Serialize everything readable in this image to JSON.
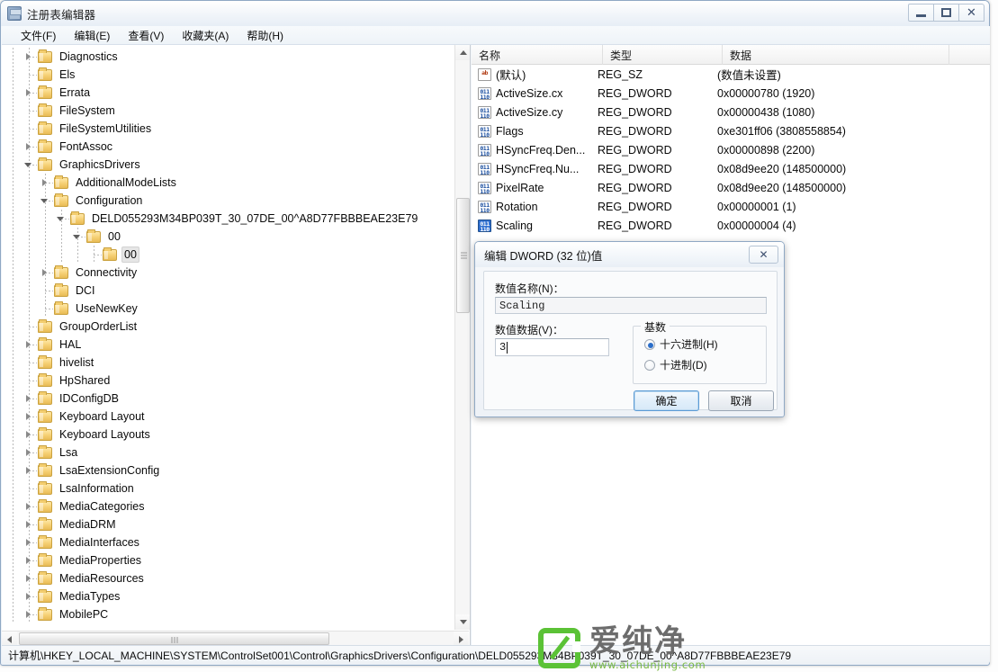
{
  "window": {
    "title": "注册表编辑器",
    "controls": {
      "minimize": "—",
      "maximize": "□",
      "close": "✕"
    }
  },
  "menu": {
    "items": [
      {
        "label": "文件(F)"
      },
      {
        "label": "编辑(E)"
      },
      {
        "label": "查看(V)"
      },
      {
        "label": "收藏夹(A)"
      },
      {
        "label": "帮助(H)"
      }
    ]
  },
  "tree": {
    "nodes": [
      {
        "label": "Diagnostics",
        "depth": 3,
        "arrow": "collapsed",
        "selected": false
      },
      {
        "label": "Els",
        "depth": 3,
        "arrow": "none",
        "selected": false
      },
      {
        "label": "Errata",
        "depth": 3,
        "arrow": "collapsed",
        "selected": false
      },
      {
        "label": "FileSystem",
        "depth": 3,
        "arrow": "none",
        "selected": false
      },
      {
        "label": "FileSystemUtilities",
        "depth": 3,
        "arrow": "none",
        "selected": false
      },
      {
        "label": "FontAssoc",
        "depth": 3,
        "arrow": "collapsed",
        "selected": false
      },
      {
        "label": "GraphicsDrivers",
        "depth": 3,
        "arrow": "expanded",
        "selected": false
      },
      {
        "label": "AdditionalModeLists",
        "depth": 4,
        "arrow": "collapsed",
        "selected": false
      },
      {
        "label": "Configuration",
        "depth": 4,
        "arrow": "expanded",
        "selected": false
      },
      {
        "label": "DELD055293M34BP039T_30_07DE_00^A8D77FBBBEAE23E79",
        "depth": 5,
        "arrow": "expanded",
        "selected": false
      },
      {
        "label": "00",
        "depth": 6,
        "arrow": "expanded",
        "selected": false
      },
      {
        "label": "00",
        "depth": 7,
        "arrow": "none",
        "selected": true
      },
      {
        "label": "Connectivity",
        "depth": 4,
        "arrow": "collapsed",
        "selected": false
      },
      {
        "label": "DCI",
        "depth": 4,
        "arrow": "none",
        "selected": false
      },
      {
        "label": "UseNewKey",
        "depth": 4,
        "arrow": "none",
        "selected": false
      },
      {
        "label": "GroupOrderList",
        "depth": 3,
        "arrow": "none",
        "selected": false
      },
      {
        "label": "HAL",
        "depth": 3,
        "arrow": "collapsed",
        "selected": false
      },
      {
        "label": "hivelist",
        "depth": 3,
        "arrow": "none",
        "selected": false
      },
      {
        "label": "HpShared",
        "depth": 3,
        "arrow": "none",
        "selected": false
      },
      {
        "label": "IDConfigDB",
        "depth": 3,
        "arrow": "collapsed",
        "selected": false
      },
      {
        "label": "Keyboard Layout",
        "depth": 3,
        "arrow": "collapsed",
        "selected": false
      },
      {
        "label": "Keyboard Layouts",
        "depth": 3,
        "arrow": "collapsed",
        "selected": false
      },
      {
        "label": "Lsa",
        "depth": 3,
        "arrow": "collapsed",
        "selected": false
      },
      {
        "label": "LsaExtensionConfig",
        "depth": 3,
        "arrow": "collapsed",
        "selected": false
      },
      {
        "label": "LsaInformation",
        "depth": 3,
        "arrow": "none",
        "selected": false
      },
      {
        "label": "MediaCategories",
        "depth": 3,
        "arrow": "collapsed",
        "selected": false
      },
      {
        "label": "MediaDRM",
        "depth": 3,
        "arrow": "collapsed",
        "selected": false
      },
      {
        "label": "MediaInterfaces",
        "depth": 3,
        "arrow": "collapsed",
        "selected": false
      },
      {
        "label": "MediaProperties",
        "depth": 3,
        "arrow": "collapsed",
        "selected": false
      },
      {
        "label": "MediaResources",
        "depth": 3,
        "arrow": "collapsed",
        "selected": false
      },
      {
        "label": "MediaTypes",
        "depth": 3,
        "arrow": "collapsed",
        "selected": false
      },
      {
        "label": "MobilePC",
        "depth": 3,
        "arrow": "collapsed",
        "selected": false
      }
    ]
  },
  "values": {
    "columns": [
      {
        "label": "名称"
      },
      {
        "label": "类型"
      },
      {
        "label": "数据"
      }
    ],
    "rows": [
      {
        "name": "(默认)",
        "type": "REG_SZ",
        "data": "(数值未设置)",
        "icon": "string-value-icon",
        "selected": false
      },
      {
        "name": "ActiveSize.cx",
        "type": "REG_DWORD",
        "data": "0x00000780 (1920)",
        "icon": "dword-value-icon",
        "selected": false
      },
      {
        "name": "ActiveSize.cy",
        "type": "REG_DWORD",
        "data": "0x00000438 (1080)",
        "icon": "dword-value-icon",
        "selected": false
      },
      {
        "name": "Flags",
        "type": "REG_DWORD",
        "data": "0xe301ff06 (3808558854)",
        "icon": "dword-value-icon",
        "selected": false
      },
      {
        "name": "HSyncFreq.Den...",
        "type": "REG_DWORD",
        "data": "0x00000898 (2200)",
        "icon": "dword-value-icon",
        "selected": false
      },
      {
        "name": "HSyncFreq.Nu...",
        "type": "REG_DWORD",
        "data": "0x08d9ee20 (148500000)",
        "icon": "dword-value-icon",
        "selected": false
      },
      {
        "name": "PixelRate",
        "type": "REG_DWORD",
        "data": "0x08d9ee20 (148500000)",
        "icon": "dword-value-icon",
        "selected": false
      },
      {
        "name": "Rotation",
        "type": "REG_DWORD",
        "data": "0x00000001 (1)",
        "icon": "dword-value-icon",
        "selected": false
      },
      {
        "name": "Scaling",
        "type": "REG_DWORD",
        "data": "0x00000004 (4)",
        "icon": "dword-value-icon",
        "selected": true
      }
    ]
  },
  "dialog": {
    "title": "编辑 DWORD (32 位)值",
    "close_label": "✕",
    "name_label": "数值名称(N)：",
    "name_value": "Scaling",
    "data_label": "数值数据(V)：",
    "data_value": "3",
    "base_group_label": "基数",
    "radio_hex": "十六进制(H)",
    "radio_dec": "十进制(D)",
    "radio_selected": "hex",
    "ok_label": "确定",
    "cancel_label": "取消"
  },
  "statusbar": {
    "path": "计算机\\HKEY_LOCAL_MACHINE\\SYSTEM\\ControlSet001\\Control\\GraphicsDrivers\\Configuration\\DELD055293M34BP039T_30_07DE_00^A8D77FBBBEAE23E79"
  },
  "watermark": {
    "name": "爱纯净",
    "url": "www.aichunjing.com",
    "accent": "#5bc236"
  }
}
